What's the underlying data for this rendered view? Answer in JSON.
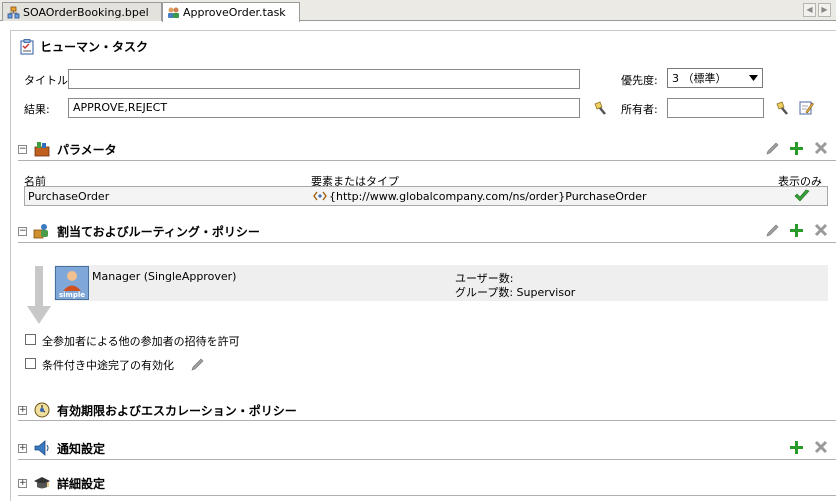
{
  "tabs": [
    {
      "label": "SOAOrderBooking.bpel",
      "icon": "bpel-icon"
    },
    {
      "label": "ApproveOrder.task",
      "icon": "task-icon"
    }
  ],
  "header": {
    "title": "ヒューマン・タスク"
  },
  "form": {
    "title_label": "タイトル:",
    "title_value": "",
    "outcome_label": "結果:",
    "outcome_value": "APPROVE,REJECT",
    "priority_label": "優先度:",
    "priority_value": "3 （標準）",
    "owner_label": "所有者:",
    "owner_value": ""
  },
  "parameters": {
    "heading": "パラメータ",
    "columns": [
      "名前",
      "要素またはタイプ",
      "表示のみ"
    ],
    "rows": [
      {
        "name": "PurchaseOrder",
        "type": "{http://www.globalcompany.com/ns/order}PurchaseOrder"
      }
    ]
  },
  "assignment": {
    "heading": "割当ておよびルーティング・ポリシー",
    "participant": "Manager (SingleApprover)",
    "participant_badge": "simple",
    "users_label": "ユーザー数:",
    "groups_label": "グループ数: Supervisor",
    "allow_invite_label": "全参加者による他の参加者の招待を許可",
    "early_completion_label": "条件付き中途完了の有効化"
  },
  "expiration": {
    "heading": "有効期限およびエスカレーション・ポリシー"
  },
  "notification": {
    "heading": "通知設定"
  },
  "advanced": {
    "heading": "詳細設定"
  },
  "colors": {
    "accent_green": "#2a9a2a",
    "tab_bg": "#eceae4"
  }
}
